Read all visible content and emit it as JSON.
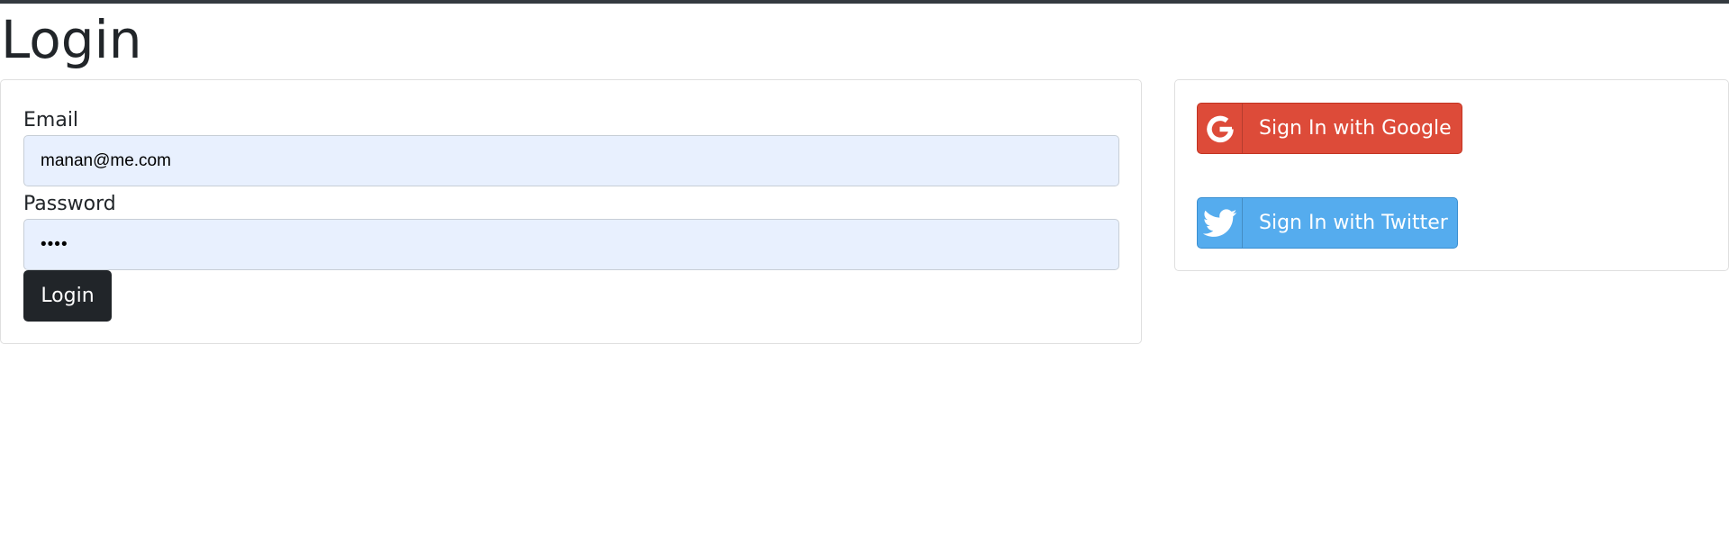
{
  "page": {
    "title": "Login"
  },
  "login_form": {
    "email_label": "Email",
    "email_value": "manan@me.com",
    "password_label": "Password",
    "password_value": "••••",
    "submit_label": "Login"
  },
  "social": {
    "google_label": "Sign In with Google",
    "google_icon": "google-g-icon",
    "google_color": "#dd4b39",
    "twitter_label": "Sign In with Twitter",
    "twitter_icon": "twitter-bird-icon",
    "twitter_color": "#55acee"
  }
}
